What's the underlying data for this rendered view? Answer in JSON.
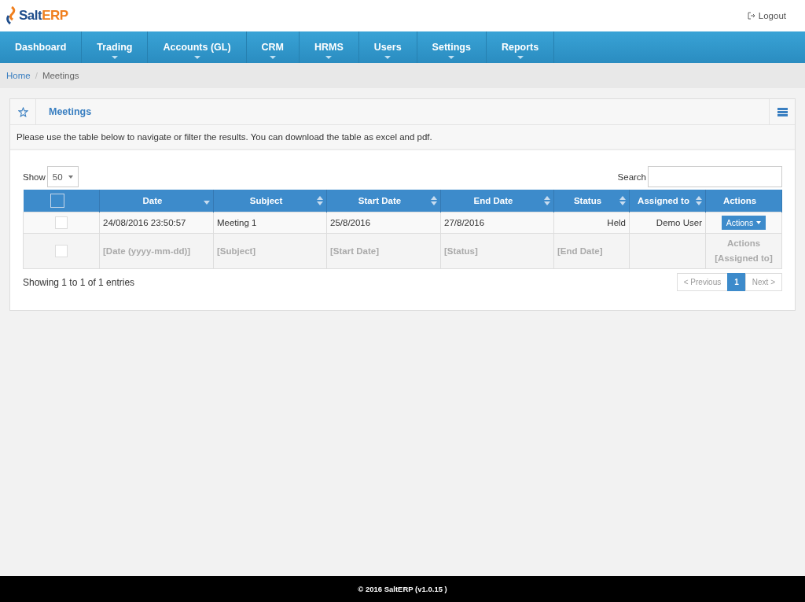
{
  "header": {
    "logo": {
      "part_1": "Salt",
      "part_2": "ERP"
    },
    "logout": "Logout"
  },
  "nav": [
    {
      "label": "Dashboard",
      "has_dropdown": false
    },
    {
      "label": "Trading",
      "has_dropdown": true
    },
    {
      "label": "Accounts (GL)",
      "has_dropdown": true
    },
    {
      "label": "CRM",
      "has_dropdown": true
    },
    {
      "label": "HRMS",
      "has_dropdown": true
    },
    {
      "label": "Users",
      "has_dropdown": true
    },
    {
      "label": "Settings",
      "has_dropdown": true
    },
    {
      "label": "Reports",
      "has_dropdown": true
    }
  ],
  "breadcrumb": {
    "items": [
      "Home",
      "Meetings"
    ],
    "separator": "/"
  },
  "panel": {
    "title": "Meetings",
    "description": "Please use the table below to navigate or filter the results. You can download the table as excel and pdf.",
    "show_label": "Show",
    "page_size": "50",
    "search_label": "Search",
    "table": {
      "select_all_checked": false,
      "columns": [
        {
          "label": "Date",
          "kind": "sorted"
        },
        {
          "label": "Subject",
          "kind": "sortable"
        },
        {
          "label": "Start Date",
          "kind": "sortable"
        },
        {
          "label": "End Date",
          "kind": "sortable"
        },
        {
          "label": "Status",
          "kind": "sortable"
        },
        {
          "label": "Assigned to",
          "kind": "sortable"
        },
        {
          "label": "Actions",
          "kind": "plain"
        }
      ],
      "rows": [
        {
          "selected": false,
          "date": "24/08/2016 23:50:57",
          "subject": "Meeting 1",
          "start_date": "25/8/2016",
          "end_date": "27/8/2016",
          "status": "Held",
          "assigned_to": "Demo User",
          "action": "Actions"
        }
      ],
      "filter_row": {
        "checked": false,
        "cells": [
          [
            "[Date (yyyy-mm-dd)]"
          ],
          [
            "[Subject]"
          ],
          [
            "[Start Date]"
          ],
          [
            "[Status]"
          ],
          [
            "[End Date]"
          ],
          [],
          [
            "Actions",
            "[Assigned to]"
          ]
        ]
      }
    },
    "info": "Showing 1 to 1 of 1 entries",
    "pagination": [
      {
        "label": "< Previous",
        "selected": false
      },
      {
        "label": "1",
        "selected": true
      },
      {
        "label": "Next >",
        "selected": false
      }
    ]
  },
  "footer": "© 2016 SaltERP (v1.0.15 )"
}
